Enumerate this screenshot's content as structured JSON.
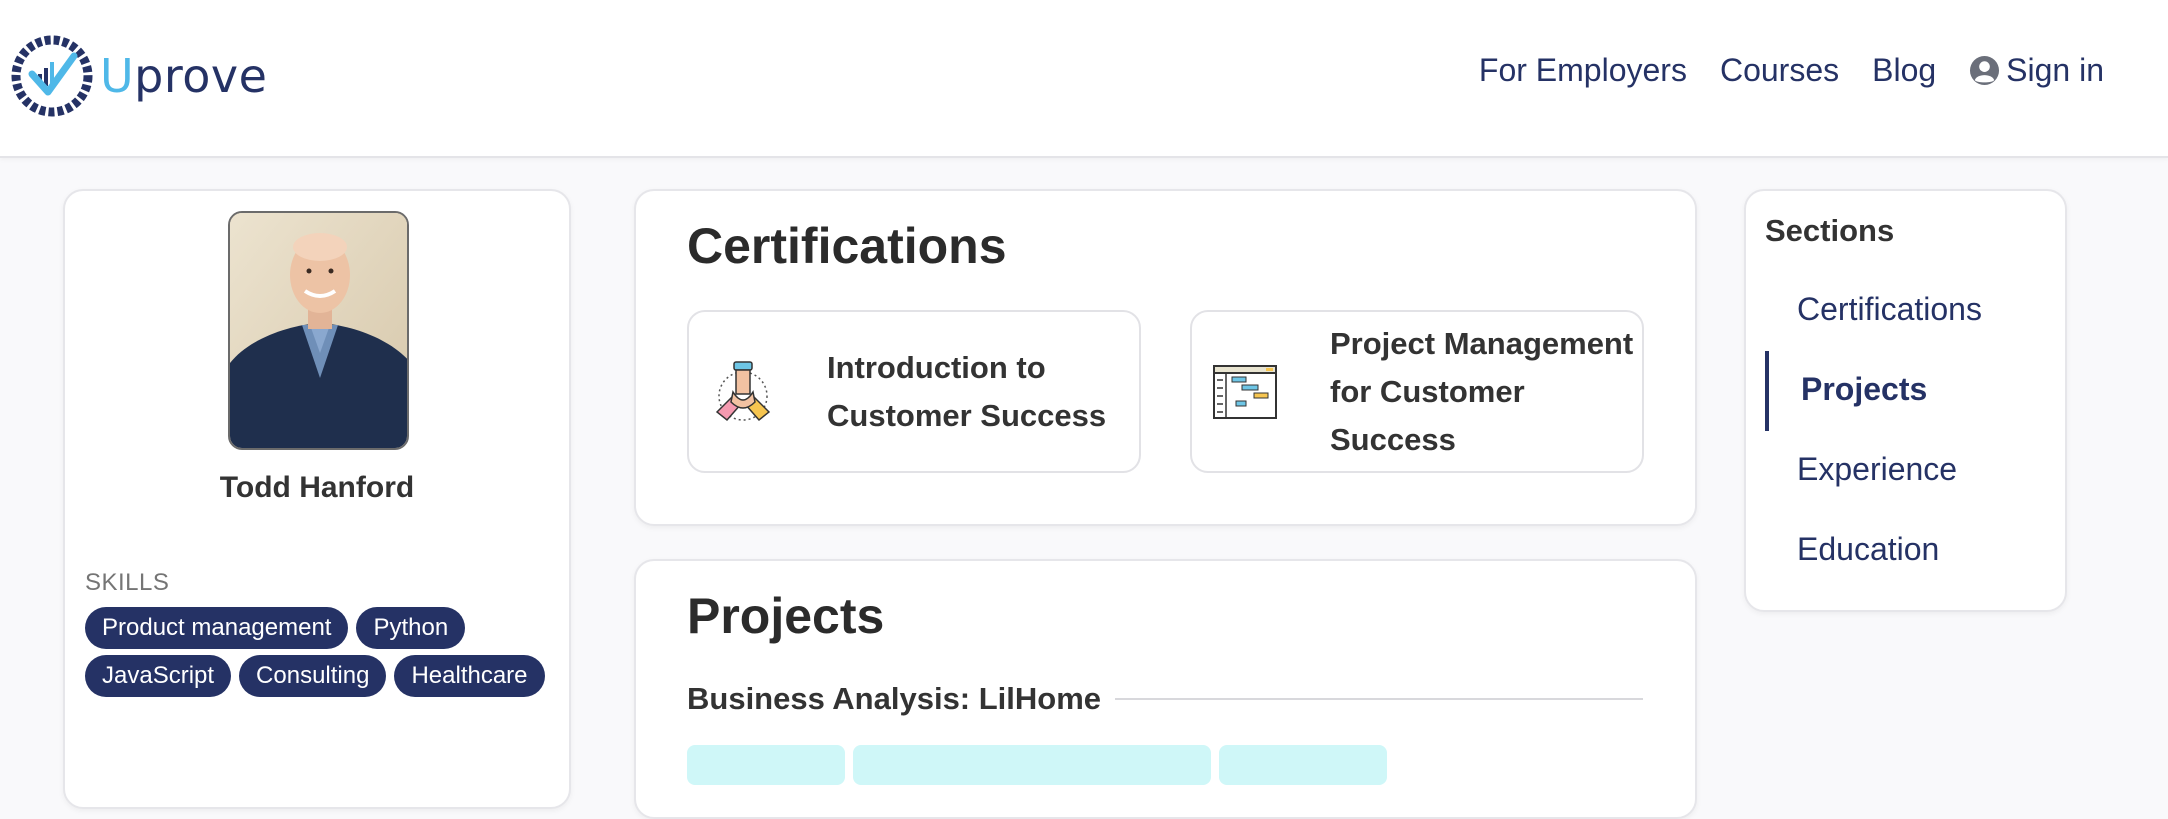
{
  "header": {
    "logo": {
      "first_letter": "U",
      "rest": "prove"
    },
    "nav": [
      {
        "label": "For Employers"
      },
      {
        "label": "Courses"
      },
      {
        "label": "Blog"
      },
      {
        "label": "Sign in",
        "icon": "user-circle-icon"
      }
    ]
  },
  "profile": {
    "name": "Todd Hanford",
    "skills_label": "SKILLS",
    "skills": [
      "Product management",
      "Python",
      "JavaScript",
      "Consulting",
      "Healthcare"
    ]
  },
  "certifications": {
    "title": "Certifications",
    "items": [
      {
        "line1": "Introduction to",
        "line2": "Customer Success",
        "icon": "teamwork-hands-icon"
      },
      {
        "line1": "Project Management",
        "line2": "for Customer Success",
        "icon": "gantt-chart-icon"
      }
    ]
  },
  "projects": {
    "title": "Projects",
    "items": [
      {
        "title": "Business Analysis: LilHome"
      }
    ]
  },
  "sections": {
    "title": "Sections",
    "items": [
      "Certifications",
      "Projects",
      "Experience",
      "Education"
    ],
    "active": "Projects"
  },
  "colors": {
    "brand_navy": "#253265",
    "brand_light_blue": "#4fb8e8",
    "tag_cyan": "#cff7f8"
  }
}
